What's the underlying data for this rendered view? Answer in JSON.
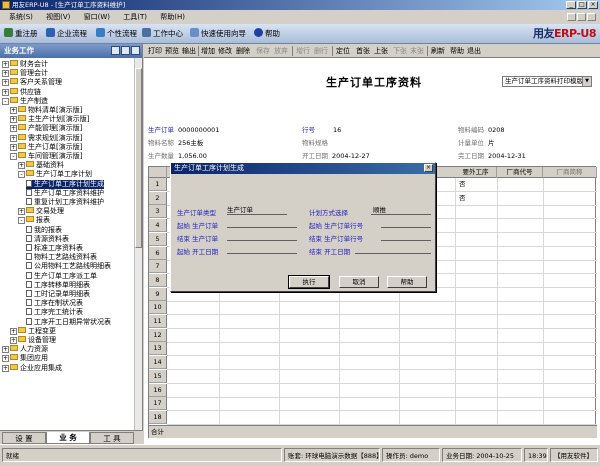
{
  "window": {
    "title": "用友ERP-U8 - [生产订单工序资料维护]",
    "controls": [
      "_",
      "□",
      "×"
    ]
  },
  "menu": [
    "系统(S)",
    "视图(V)",
    "窗口(W)",
    "工具(T)",
    "帮助(H)"
  ],
  "toolbar_main": {
    "items": [
      {
        "label": "重注册",
        "icon": "refresh-icon"
      },
      {
        "label": "企业流程",
        "icon": "flow-icon"
      },
      {
        "label": "个性流程",
        "icon": "custom-flow-icon"
      },
      {
        "label": "工作中心",
        "icon": "work-center-icon"
      },
      {
        "label": "快速使用向导",
        "icon": "wizard-icon"
      },
      {
        "label": "帮助",
        "icon": "help-icon"
      }
    ],
    "brand": "用友ERP-U8"
  },
  "left_panel": {
    "title": "业务工作",
    "tabs": [
      "设 置",
      "业 务",
      "工 具"
    ],
    "active_tab": "业 务",
    "tree": [
      {
        "label": "财务会计",
        "level": 0,
        "type": "folder",
        "toggle": "+"
      },
      {
        "label": "管理会计",
        "level": 0,
        "type": "folder",
        "toggle": "+"
      },
      {
        "label": "客户关系管理",
        "level": 0,
        "type": "folder",
        "toggle": "+"
      },
      {
        "label": "供应链",
        "level": 0,
        "type": "folder",
        "toggle": "+"
      },
      {
        "label": "生产制造",
        "level": 0,
        "type": "folder",
        "toggle": "-"
      },
      {
        "label": "物料清单[演示版]",
        "level": 1,
        "type": "folder",
        "toggle": "+"
      },
      {
        "label": "主生产计划[演示版]",
        "level": 1,
        "type": "folder",
        "toggle": "+"
      },
      {
        "label": "产能管理[演示版]",
        "level": 1,
        "type": "folder",
        "toggle": "+"
      },
      {
        "label": "需求规划[演示版]",
        "level": 1,
        "type": "folder",
        "toggle": "+"
      },
      {
        "label": "生产订单[演示版]",
        "level": 1,
        "type": "folder",
        "toggle": "+"
      },
      {
        "label": "车间管理[演示版]",
        "level": 1,
        "type": "folder",
        "toggle": "-"
      },
      {
        "label": "基础资料",
        "level": 2,
        "type": "folder",
        "toggle": "+"
      },
      {
        "label": "生产订单工序计划",
        "level": 2,
        "type": "folder",
        "toggle": "-"
      },
      {
        "label": "生产订单工序计划生成",
        "level": 3,
        "type": "doc",
        "selected": true
      },
      {
        "label": "生产订单工序资料维护",
        "level": 3,
        "type": "doc"
      },
      {
        "label": "重复计划工序资料维护",
        "level": 3,
        "type": "doc"
      },
      {
        "label": "交易处理",
        "level": 2,
        "type": "folder",
        "toggle": "+"
      },
      {
        "label": "报表",
        "level": 2,
        "type": "folder",
        "toggle": "-"
      },
      {
        "label": "我的报表",
        "level": 3,
        "type": "doc"
      },
      {
        "label": "清源资料表",
        "level": 3,
        "type": "doc"
      },
      {
        "label": "标准工序资料表",
        "level": 3,
        "type": "doc"
      },
      {
        "label": "物料工艺路线资料表",
        "level": 3,
        "type": "doc"
      },
      {
        "label": "公用物料工艺路线明细表",
        "level": 3,
        "type": "doc"
      },
      {
        "label": "生产订单工序派工单",
        "level": 3,
        "type": "doc"
      },
      {
        "label": "工序转移单明细表",
        "level": 3,
        "type": "doc"
      },
      {
        "label": "工时记录单明细表",
        "level": 3,
        "type": "doc"
      },
      {
        "label": "工序在制状况表",
        "level": 3,
        "type": "doc"
      },
      {
        "label": "工序完工统计表",
        "level": 3,
        "type": "doc"
      },
      {
        "label": "工序开工日期异常状况表",
        "level": 3,
        "type": "doc"
      },
      {
        "label": "工程变更",
        "level": 1,
        "type": "folder",
        "toggle": "+"
      },
      {
        "label": "设备管理",
        "level": 1,
        "type": "folder",
        "toggle": "+"
      },
      {
        "label": "人力资源",
        "level": 0,
        "type": "folder",
        "toggle": "+"
      },
      {
        "label": "集团应用",
        "level": 0,
        "type": "folder",
        "toggle": "+"
      },
      {
        "label": "企业应用集成",
        "level": 0,
        "type": "folder",
        "toggle": "+"
      }
    ]
  },
  "doc_toolbar": [
    {
      "label": "打印",
      "enabled": true
    },
    {
      "label": "预览",
      "enabled": true
    },
    {
      "label": "输出",
      "enabled": true
    },
    {
      "label": "增加",
      "enabled": true
    },
    {
      "label": "修改",
      "enabled": true
    },
    {
      "label": "删除",
      "enabled": true
    },
    {
      "label": "保存",
      "enabled": false
    },
    {
      "label": "放弃",
      "enabled": false
    },
    {
      "label": "增行",
      "enabled": false
    },
    {
      "label": "删行",
      "enabled": false
    },
    {
      "label": "定位",
      "enabled": true
    },
    {
      "label": "首张",
      "enabled": true
    },
    {
      "label": "上张",
      "enabled": true
    },
    {
      "label": "下张",
      "enabled": false
    },
    {
      "label": "末张",
      "enabled": false
    },
    {
      "label": "刷新",
      "enabled": true
    },
    {
      "label": "帮助",
      "enabled": true
    },
    {
      "label": "退出",
      "enabled": true
    }
  ],
  "document": {
    "title": "生产订单工序资料",
    "template_select": "生产订单工序资料打印模版",
    "fields": {
      "order_no": {
        "label": "生产订单",
        "value": "0000000001"
      },
      "line_no": {
        "label": "行号",
        "value": "16"
      },
      "material_code": {
        "label": "物料编码",
        "value": "0208"
      },
      "material_name": {
        "label": "物料名称",
        "value": "256主板"
      },
      "material_spec": {
        "label": "物料规格",
        "value": ""
      },
      "unit": {
        "label": "计量单位",
        "value": "片"
      },
      "qty": {
        "label": "生产数量",
        "value": "1,056.00"
      },
      "start_date": {
        "label": "开工日期",
        "value": "2004-12-27"
      },
      "end_date": {
        "label": "完工日期",
        "value": "2004-12-31"
      }
    },
    "grid": {
      "headers": [
        "要外工序",
        "厂商代号",
        "厂商简称"
      ],
      "rows": [
        "1",
        "2",
        "3",
        "4",
        "5",
        "6",
        "7",
        "8",
        "9",
        "10",
        "11",
        "12",
        "13",
        "14",
        "15",
        "16",
        "17",
        "18"
      ],
      "cells": [
        {
          "row": 0,
          "value": "否"
        },
        {
          "row": 1,
          "value": "否"
        }
      ],
      "total_label": "合计"
    }
  },
  "dialog": {
    "title": "生产订单工序计划生成",
    "close": "×",
    "order_type": {
      "label": "生产订单类型",
      "value": "生产订单"
    },
    "calc_method": {
      "label": "计划方式选择",
      "value": "顺推"
    },
    "start_order": {
      "label": "起始 生产订单",
      "value": ""
    },
    "start_line": {
      "label": "起始 生产订单行号",
      "value": ""
    },
    "end_order": {
      "label": "结束 生产订单",
      "value": ""
    },
    "end_line": {
      "label": "结束 生产订单行号",
      "value": ""
    },
    "start_date": {
      "label": "起始 开工日期",
      "value": ""
    },
    "end_date": {
      "label": "结束 开工日期",
      "value": ""
    },
    "buttons": {
      "execute": "执行",
      "cancel": "取消",
      "help": "帮助"
    }
  },
  "status": {
    "ready": "就绪",
    "account": "账套: 环球电脑演示数据【888】",
    "operator": "操作员: demo",
    "biz_date": "业务日期: 2004-10-25",
    "time": "18:39",
    "company": "【用友软件】"
  }
}
